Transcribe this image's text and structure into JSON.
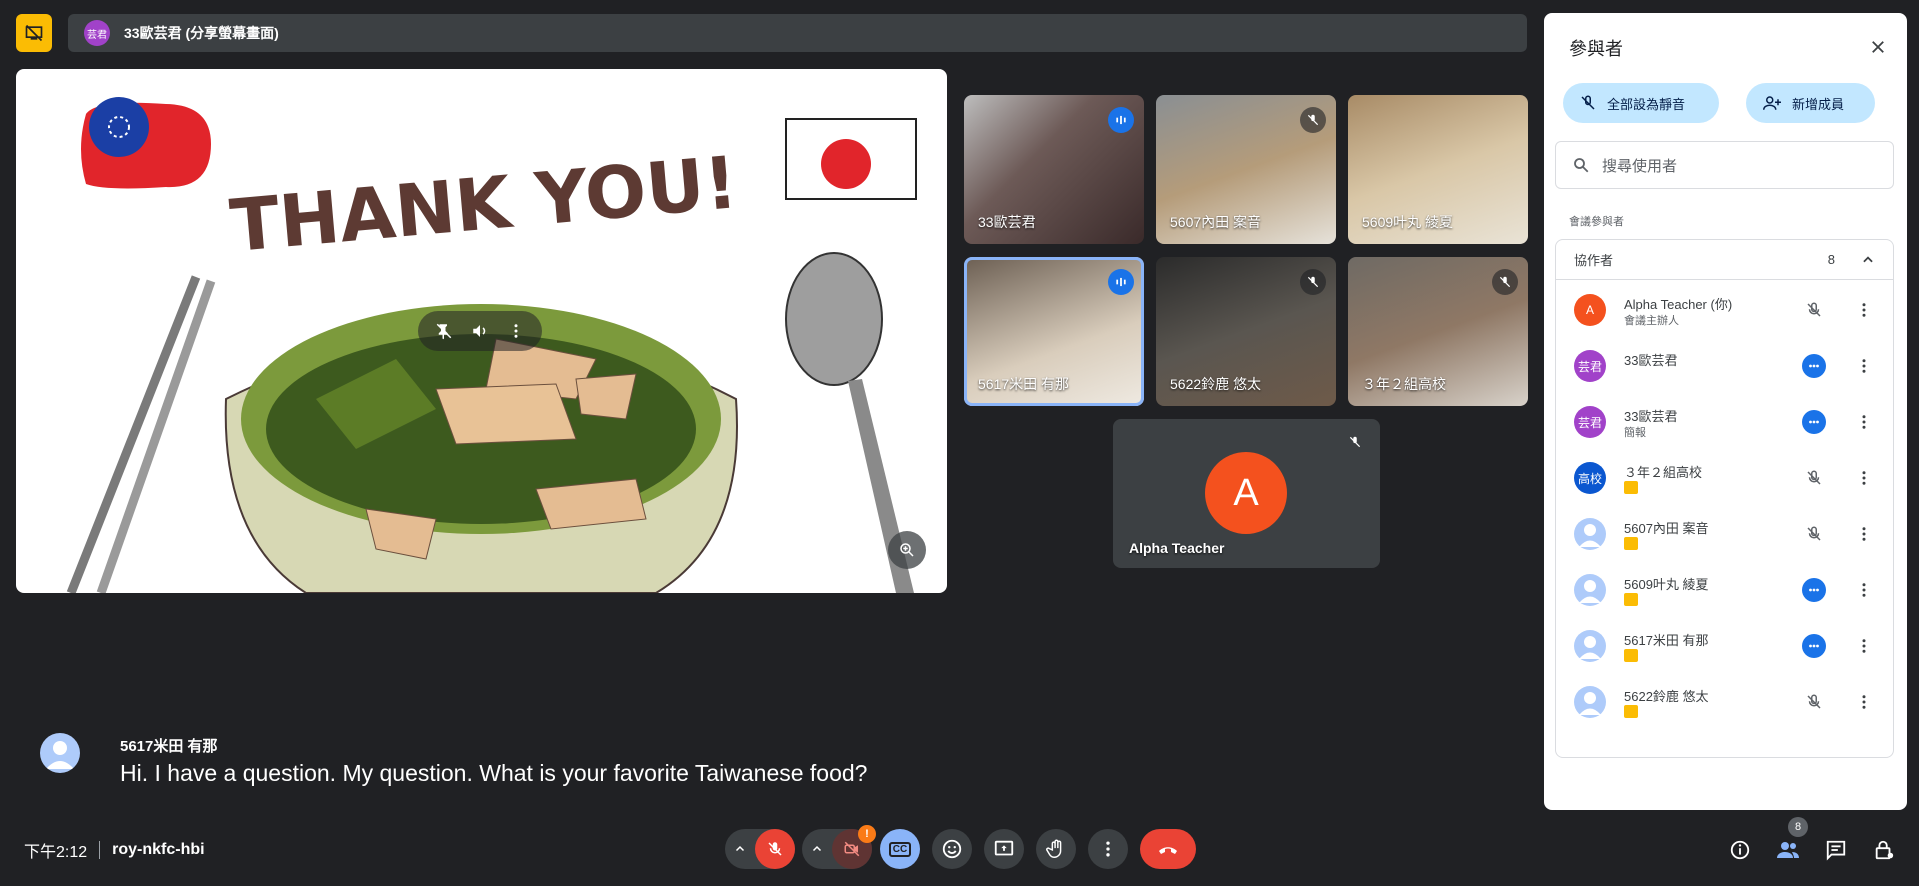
{
  "presenting": {
    "label": "33歐芸君 (分享螢幕畫面)",
    "avatar_text": "芸君"
  },
  "slide": {
    "headline": "THANK YOU!"
  },
  "tiles": [
    {
      "name": "33歐芸君",
      "status": "speaking"
    },
    {
      "name": "5607內田 案音",
      "status": "muted"
    },
    {
      "name": "5609叶丸 綾夏",
      "status": "none"
    },
    {
      "name": "5617米田 有那",
      "status": "speaking"
    },
    {
      "name": "5622鈴鹿 悠太",
      "status": "muted"
    },
    {
      "name": "３年２組高校",
      "status": "muted"
    }
  ],
  "alpha_tile": {
    "name": "Alpha Teacher",
    "initial": "A"
  },
  "caption": {
    "speaker": "5617米田 有那",
    "text": "Hi. I have a question. My question. What is your favorite Taiwanese food?"
  },
  "meeting": {
    "time": "下午2:12",
    "code": "roy-nkfc-hbi"
  },
  "controls": {
    "participants_count": "8",
    "warning_mark": "!",
    "cc_label": "CC"
  },
  "panel": {
    "title": "參與者",
    "mute_all": "全部設為靜音",
    "add_people": "新增成員",
    "search_placeholder": "搜尋使用者",
    "section_label": "會議參與者",
    "group_name": "協作者",
    "group_count": "8",
    "participants": [
      {
        "name": "Alpha Teacher (你)",
        "sub": "會議主辦人",
        "avatar": "A",
        "avatar_color": "#f4511e",
        "status": "muted"
      },
      {
        "name": "33歐芸君",
        "sub": "",
        "avatar": "芸君",
        "avatar_color": "#a142c9",
        "status": "speaking"
      },
      {
        "name": "33歐芸君",
        "sub": "簡報",
        "avatar": "芸君",
        "avatar_color": "#a142c9",
        "status": "speaking"
      },
      {
        "name": "３年２組高校",
        "sub": "",
        "avatar": "高校",
        "avatar_color": "#0b57d0",
        "status": "muted"
      },
      {
        "name": "5607內田 案音",
        "sub": "",
        "avatar": "",
        "avatar_color": "#aecbfa",
        "status": "muted"
      },
      {
        "name": "5609叶丸 綾夏",
        "sub": "",
        "avatar": "",
        "avatar_color": "#aecbfa",
        "status": "speaking"
      },
      {
        "name": "5617米田 有那",
        "sub": "",
        "avatar": "",
        "avatar_color": "#aecbfa",
        "status": "speaking"
      },
      {
        "name": "5622鈴鹿 悠太",
        "sub": "",
        "avatar": "",
        "avatar_color": "#aecbfa",
        "status": "muted"
      }
    ]
  }
}
